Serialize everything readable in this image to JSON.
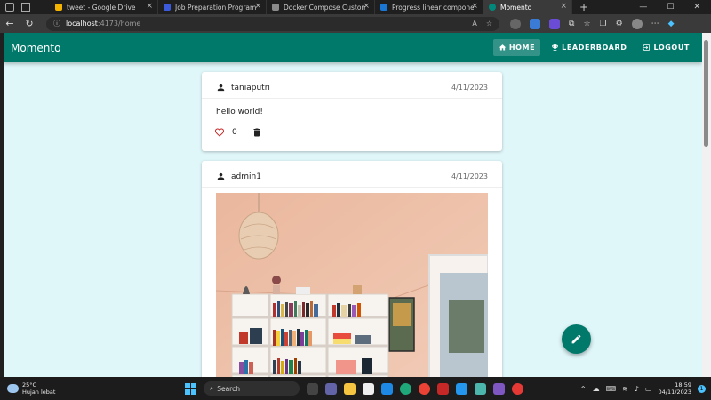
{
  "browser": {
    "tabs": [
      {
        "label": "tweet - Google Drive",
        "color": "#f4b400"
      },
      {
        "label": "Job Preparation Program Max",
        "color": "#3b5bdb"
      },
      {
        "label": "Docker Compose Custom Netw",
        "color": "#8a8a8a"
      },
      {
        "label": "Progress linear component — V",
        "color": "#1976d2"
      },
      {
        "label": "Momento",
        "color": "#00897b"
      }
    ],
    "url_host": "localhost",
    "url_path": ":4173/home"
  },
  "app": {
    "brand": "Momento",
    "nav": {
      "home": "HOME",
      "leaderboard": "LEADERBOARD",
      "logout": "LOGOUT"
    },
    "accent": "#00796b",
    "background": "#e0f7fa"
  },
  "posts": [
    {
      "user": "taniaputri",
      "date": "4/11/2023",
      "text": "hello world!",
      "likes": "0"
    },
    {
      "user": "admin1",
      "date": "4/11/2023"
    }
  ],
  "taskbar": {
    "temp": "25°C",
    "weather": "Hujan lebat",
    "search": "Search",
    "time": "18:59",
    "date": "04/11/2023",
    "notifications": "1"
  }
}
